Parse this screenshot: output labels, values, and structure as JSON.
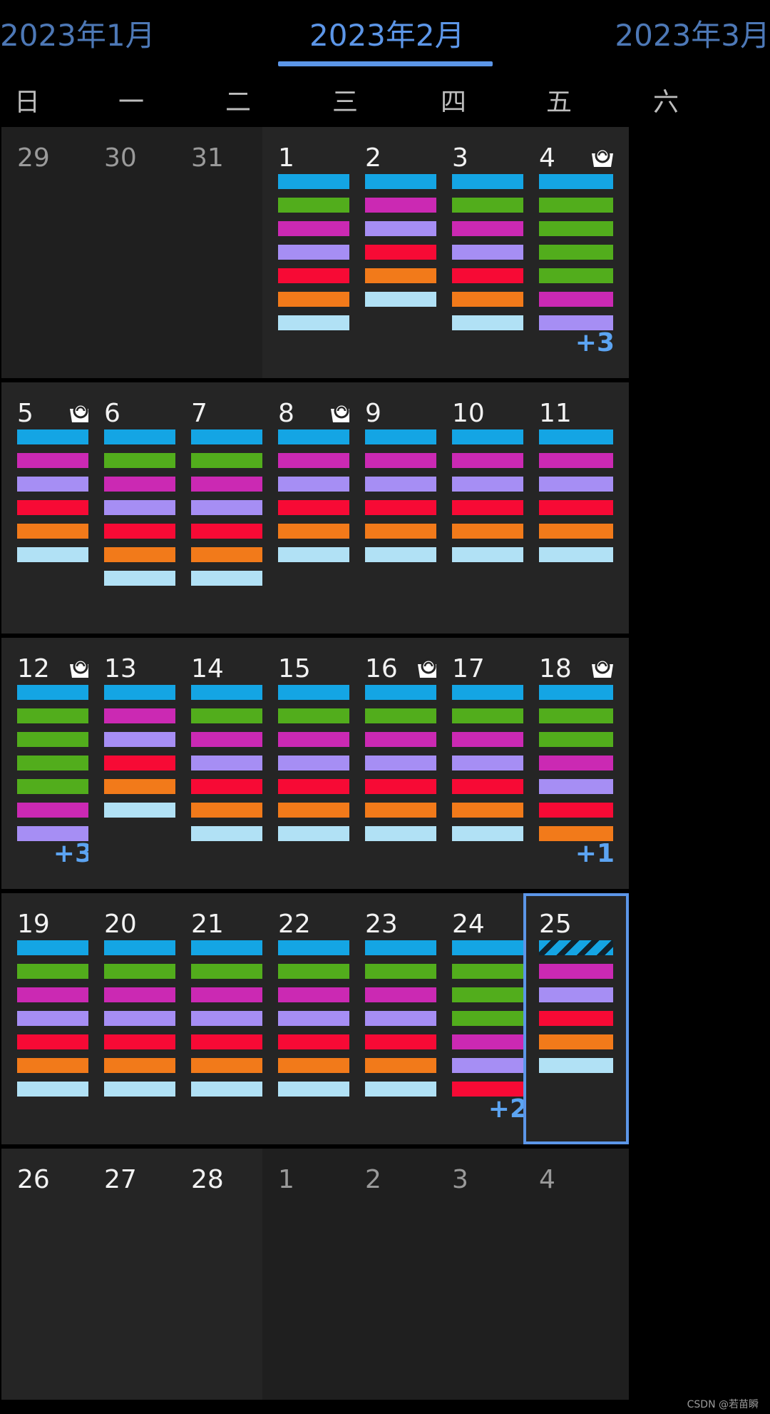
{
  "header": {
    "tabs": [
      {
        "label": "2023年1月",
        "active": false
      },
      {
        "label": "2023年2月",
        "active": true
      },
      {
        "label": "2023年3月",
        "active": false
      }
    ],
    "accent_color": "#5c96e8"
  },
  "weekdays": [
    "日",
    "一",
    "二",
    "三",
    "四",
    "五",
    "六"
  ],
  "event_colors": {
    "blue": "#14a5e4",
    "green": "#52ad1c",
    "magenta": "#cb29b3",
    "lavender": "#a68ef4",
    "red": "#f70a35",
    "orange": "#f27a1a",
    "lightblue": "#b1e1f5",
    "striped": "#14a5e4"
  },
  "badge_icon": "cup-icon",
  "weeks": [
    [
      {
        "day": "29",
        "other": true,
        "bars": []
      },
      {
        "day": "30",
        "other": true,
        "bars": []
      },
      {
        "day": "31",
        "other": true,
        "bars": []
      },
      {
        "day": "1",
        "bars": [
          "blue",
          "green",
          "magenta",
          "lavender",
          "red",
          "orange",
          "lightblue"
        ]
      },
      {
        "day": "2",
        "bars": [
          "blue",
          "magenta",
          "lavender",
          "red",
          "orange",
          "lightblue"
        ]
      },
      {
        "day": "3",
        "bars": [
          "blue",
          "green",
          "magenta",
          "lavender",
          "red",
          "orange",
          "lightblue"
        ]
      },
      {
        "day": "4",
        "badge": true,
        "bars": [
          "blue",
          "green",
          "green",
          "green",
          "green",
          "magenta",
          "lavender"
        ],
        "more": "+3"
      }
    ],
    [
      {
        "day": "5",
        "badge": true,
        "bars": [
          "blue",
          "magenta",
          "lavender",
          "red",
          "orange",
          "lightblue"
        ]
      },
      {
        "day": "6",
        "bars": [
          "blue",
          "green",
          "magenta",
          "lavender",
          "red",
          "orange",
          "lightblue"
        ]
      },
      {
        "day": "7",
        "bars": [
          "blue",
          "green",
          "magenta",
          "lavender",
          "red",
          "orange",
          "lightblue"
        ]
      },
      {
        "day": "8",
        "badge": true,
        "bars": [
          "blue",
          "magenta",
          "lavender",
          "red",
          "orange",
          "lightblue"
        ]
      },
      {
        "day": "9",
        "bars": [
          "blue",
          "magenta",
          "lavender",
          "red",
          "orange",
          "lightblue"
        ]
      },
      {
        "day": "10",
        "bars": [
          "blue",
          "magenta",
          "lavender",
          "red",
          "orange",
          "lightblue"
        ]
      },
      {
        "day": "11",
        "bars": [
          "blue",
          "magenta",
          "lavender",
          "red",
          "orange",
          "lightblue"
        ]
      }
    ],
    [
      {
        "day": "12",
        "badge": true,
        "bars": [
          "blue",
          "green",
          "green",
          "green",
          "green",
          "magenta",
          "lavender"
        ],
        "more": "+3"
      },
      {
        "day": "13",
        "bars": [
          "blue",
          "magenta",
          "lavender",
          "red",
          "orange",
          "lightblue"
        ]
      },
      {
        "day": "14",
        "bars": [
          "blue",
          "green",
          "magenta",
          "lavender",
          "red",
          "orange",
          "lightblue"
        ]
      },
      {
        "day": "15",
        "bars": [
          "blue",
          "green",
          "magenta",
          "lavender",
          "red",
          "orange",
          "lightblue"
        ]
      },
      {
        "day": "16",
        "badge": true,
        "bars": [
          "blue",
          "green",
          "magenta",
          "lavender",
          "red",
          "orange",
          "lightblue"
        ]
      },
      {
        "day": "17",
        "bars": [
          "blue",
          "green",
          "magenta",
          "lavender",
          "red",
          "orange",
          "lightblue"
        ]
      },
      {
        "day": "18",
        "badge": true,
        "bars": [
          "blue",
          "green",
          "green",
          "magenta",
          "lavender",
          "red",
          "orange"
        ],
        "more": "+1"
      }
    ],
    [
      {
        "day": "19",
        "bars": [
          "blue",
          "green",
          "magenta",
          "lavender",
          "red",
          "orange",
          "lightblue"
        ]
      },
      {
        "day": "20",
        "bars": [
          "blue",
          "green",
          "magenta",
          "lavender",
          "red",
          "orange",
          "lightblue"
        ]
      },
      {
        "day": "21",
        "bars": [
          "blue",
          "green",
          "magenta",
          "lavender",
          "red",
          "orange",
          "lightblue"
        ]
      },
      {
        "day": "22",
        "bars": [
          "blue",
          "green",
          "magenta",
          "lavender",
          "red",
          "orange",
          "lightblue"
        ]
      },
      {
        "day": "23",
        "bars": [
          "blue",
          "green",
          "magenta",
          "lavender",
          "red",
          "orange",
          "lightblue"
        ]
      },
      {
        "day": "24",
        "bars": [
          "blue",
          "green",
          "green",
          "green",
          "magenta",
          "lavender",
          "red"
        ],
        "more": "+2"
      },
      {
        "day": "25",
        "selected": true,
        "bars": [
          "striped",
          "magenta",
          "lavender",
          "red",
          "orange",
          "lightblue"
        ]
      }
    ],
    [
      {
        "day": "26",
        "bars": []
      },
      {
        "day": "27",
        "bars": []
      },
      {
        "day": "28",
        "bars": []
      },
      {
        "day": "1",
        "other": true,
        "bars": []
      },
      {
        "day": "2",
        "other": true,
        "bars": []
      },
      {
        "day": "3",
        "other": true,
        "bars": []
      },
      {
        "day": "4",
        "other": true,
        "bars": []
      }
    ]
  ],
  "watermark": "CSDN @若苗瞬"
}
